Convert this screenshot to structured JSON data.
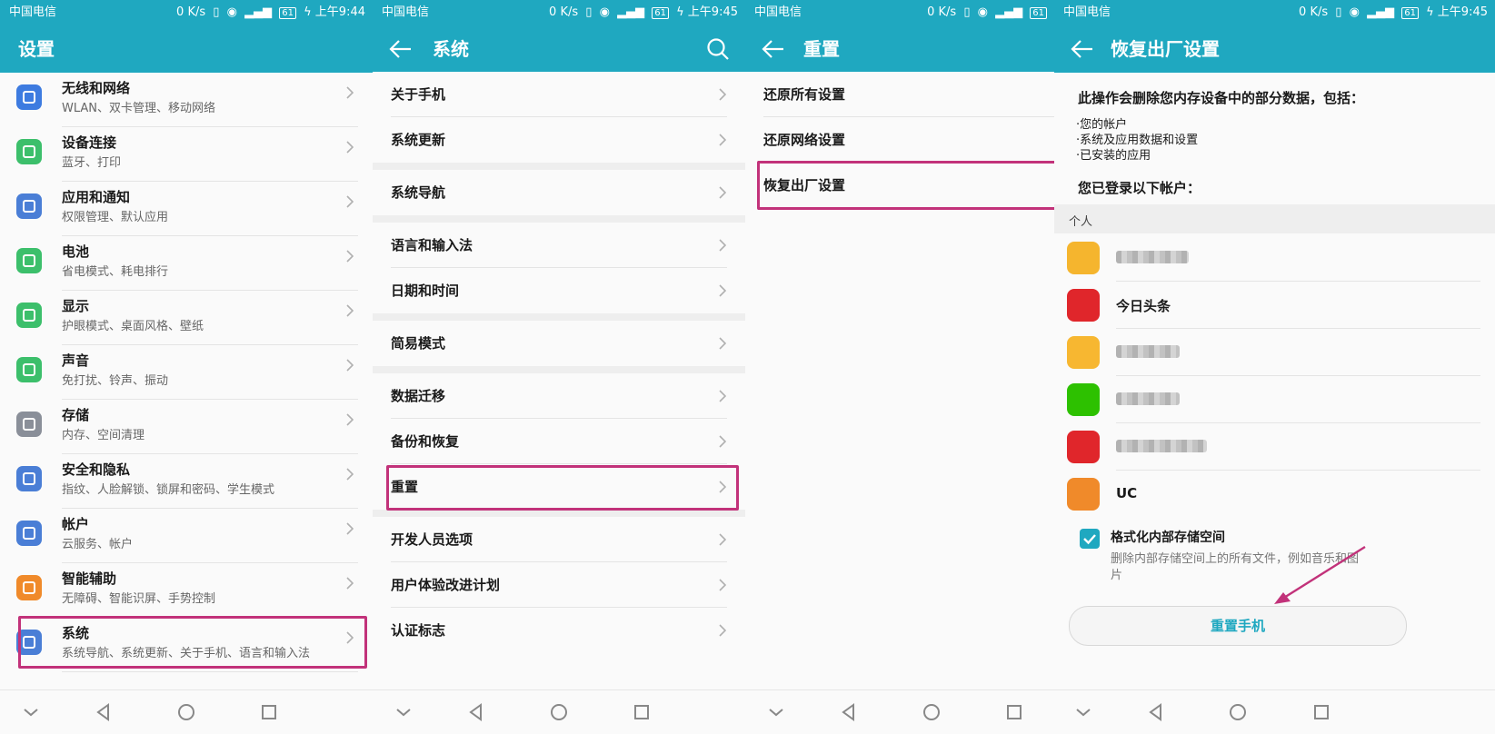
{
  "status_bar": {
    "carrier": "中国电信",
    "speed": "0 K/s",
    "battery": "61",
    "time_1": "上午9:44",
    "time_2": "上午9:45"
  },
  "colors": {
    "header": "#1fa8c0",
    "highlight": "#c2327a",
    "accent": "#1fa8c0"
  },
  "settings": {
    "title": "设置",
    "items": [
      {
        "title": "无线和网络",
        "subtitle": "WLAN、双卡管理、移动网络",
        "icon": "wifi-icon",
        "color": "#3d7be0"
      },
      {
        "title": "设备连接",
        "subtitle": "蓝牙、打印",
        "icon": "device-connect-icon",
        "color": "#3cbf6b"
      },
      {
        "title": "应用和通知",
        "subtitle": "权限管理、默认应用",
        "icon": "apps-icon",
        "color": "#4a7ed6"
      },
      {
        "title": "电池",
        "subtitle": "省电模式、耗电排行",
        "icon": "battery-icon",
        "color": "#3cbf6b"
      },
      {
        "title": "显示",
        "subtitle": "护眼模式、桌面风格、壁纸",
        "icon": "display-icon",
        "color": "#3cbf6b"
      },
      {
        "title": "声音",
        "subtitle": "免打扰、铃声、振动",
        "icon": "sound-icon",
        "color": "#3cbf6b"
      },
      {
        "title": "存储",
        "subtitle": "内存、空间清理",
        "icon": "storage-icon",
        "color": "#8a8f99"
      },
      {
        "title": "安全和隐私",
        "subtitle": "指纹、人脸解锁、锁屏和密码、学生模式",
        "icon": "shield-icon",
        "color": "#4a7ed6"
      },
      {
        "title": "帐户",
        "subtitle": "云服务、帐户",
        "icon": "account-icon",
        "color": "#4a7ed6"
      },
      {
        "title": "智能辅助",
        "subtitle": "无障碍、智能识屏、手势控制",
        "icon": "hand-icon",
        "color": "#f08a2a"
      },
      {
        "title": "系统",
        "subtitle": "系统导航、系统更新、关于手机、语言和输入法",
        "icon": "system-info-icon",
        "color": "#4a7ed6"
      }
    ]
  },
  "system": {
    "title": "系统",
    "groups": [
      [
        "关于手机",
        "系统更新"
      ],
      [
        "系统导航"
      ],
      [
        "语言和输入法",
        "日期和时间"
      ],
      [
        "简易模式"
      ],
      [
        "数据迁移",
        "备份和恢复",
        "重置"
      ],
      [
        "开发人员选项",
        "用户体验改进计划",
        "认证标志"
      ]
    ]
  },
  "reset": {
    "title": "重置",
    "items": [
      "还原所有设置",
      "还原网络设置",
      "恢复出厂设置"
    ]
  },
  "factory": {
    "title": "恢复出厂设置",
    "intro": "此操作会删除您内存设备中的部分数据，包括：",
    "bullets": [
      "·您的帐户",
      "·系统及应用数据和设置",
      "·已安装的应用"
    ],
    "logged_in": "您已登录以下帐户：",
    "section": "个人",
    "accounts": [
      {
        "name": "",
        "icon": "weibo-icon",
        "color": "#f5b52e"
      },
      {
        "name": "今日头条",
        "icon": "toutiao-icon",
        "color": "#e0262b"
      },
      {
        "name": "",
        "icon": "mail-icon",
        "color": "#f7b731"
      },
      {
        "name": "",
        "icon": "wechat-icon",
        "color": "#2dc100"
      },
      {
        "name": "",
        "icon": "huawei-icon",
        "color": "#e0262b"
      },
      {
        "name": "UC",
        "icon": "uc-icon",
        "color": "#f08a2a"
      }
    ],
    "format_label": "格式化内部存储空间",
    "format_desc_1": "删除内部存储空间上的所有文件，例如音乐和图",
    "format_desc_2": "片",
    "reset_button": "重置手机"
  }
}
